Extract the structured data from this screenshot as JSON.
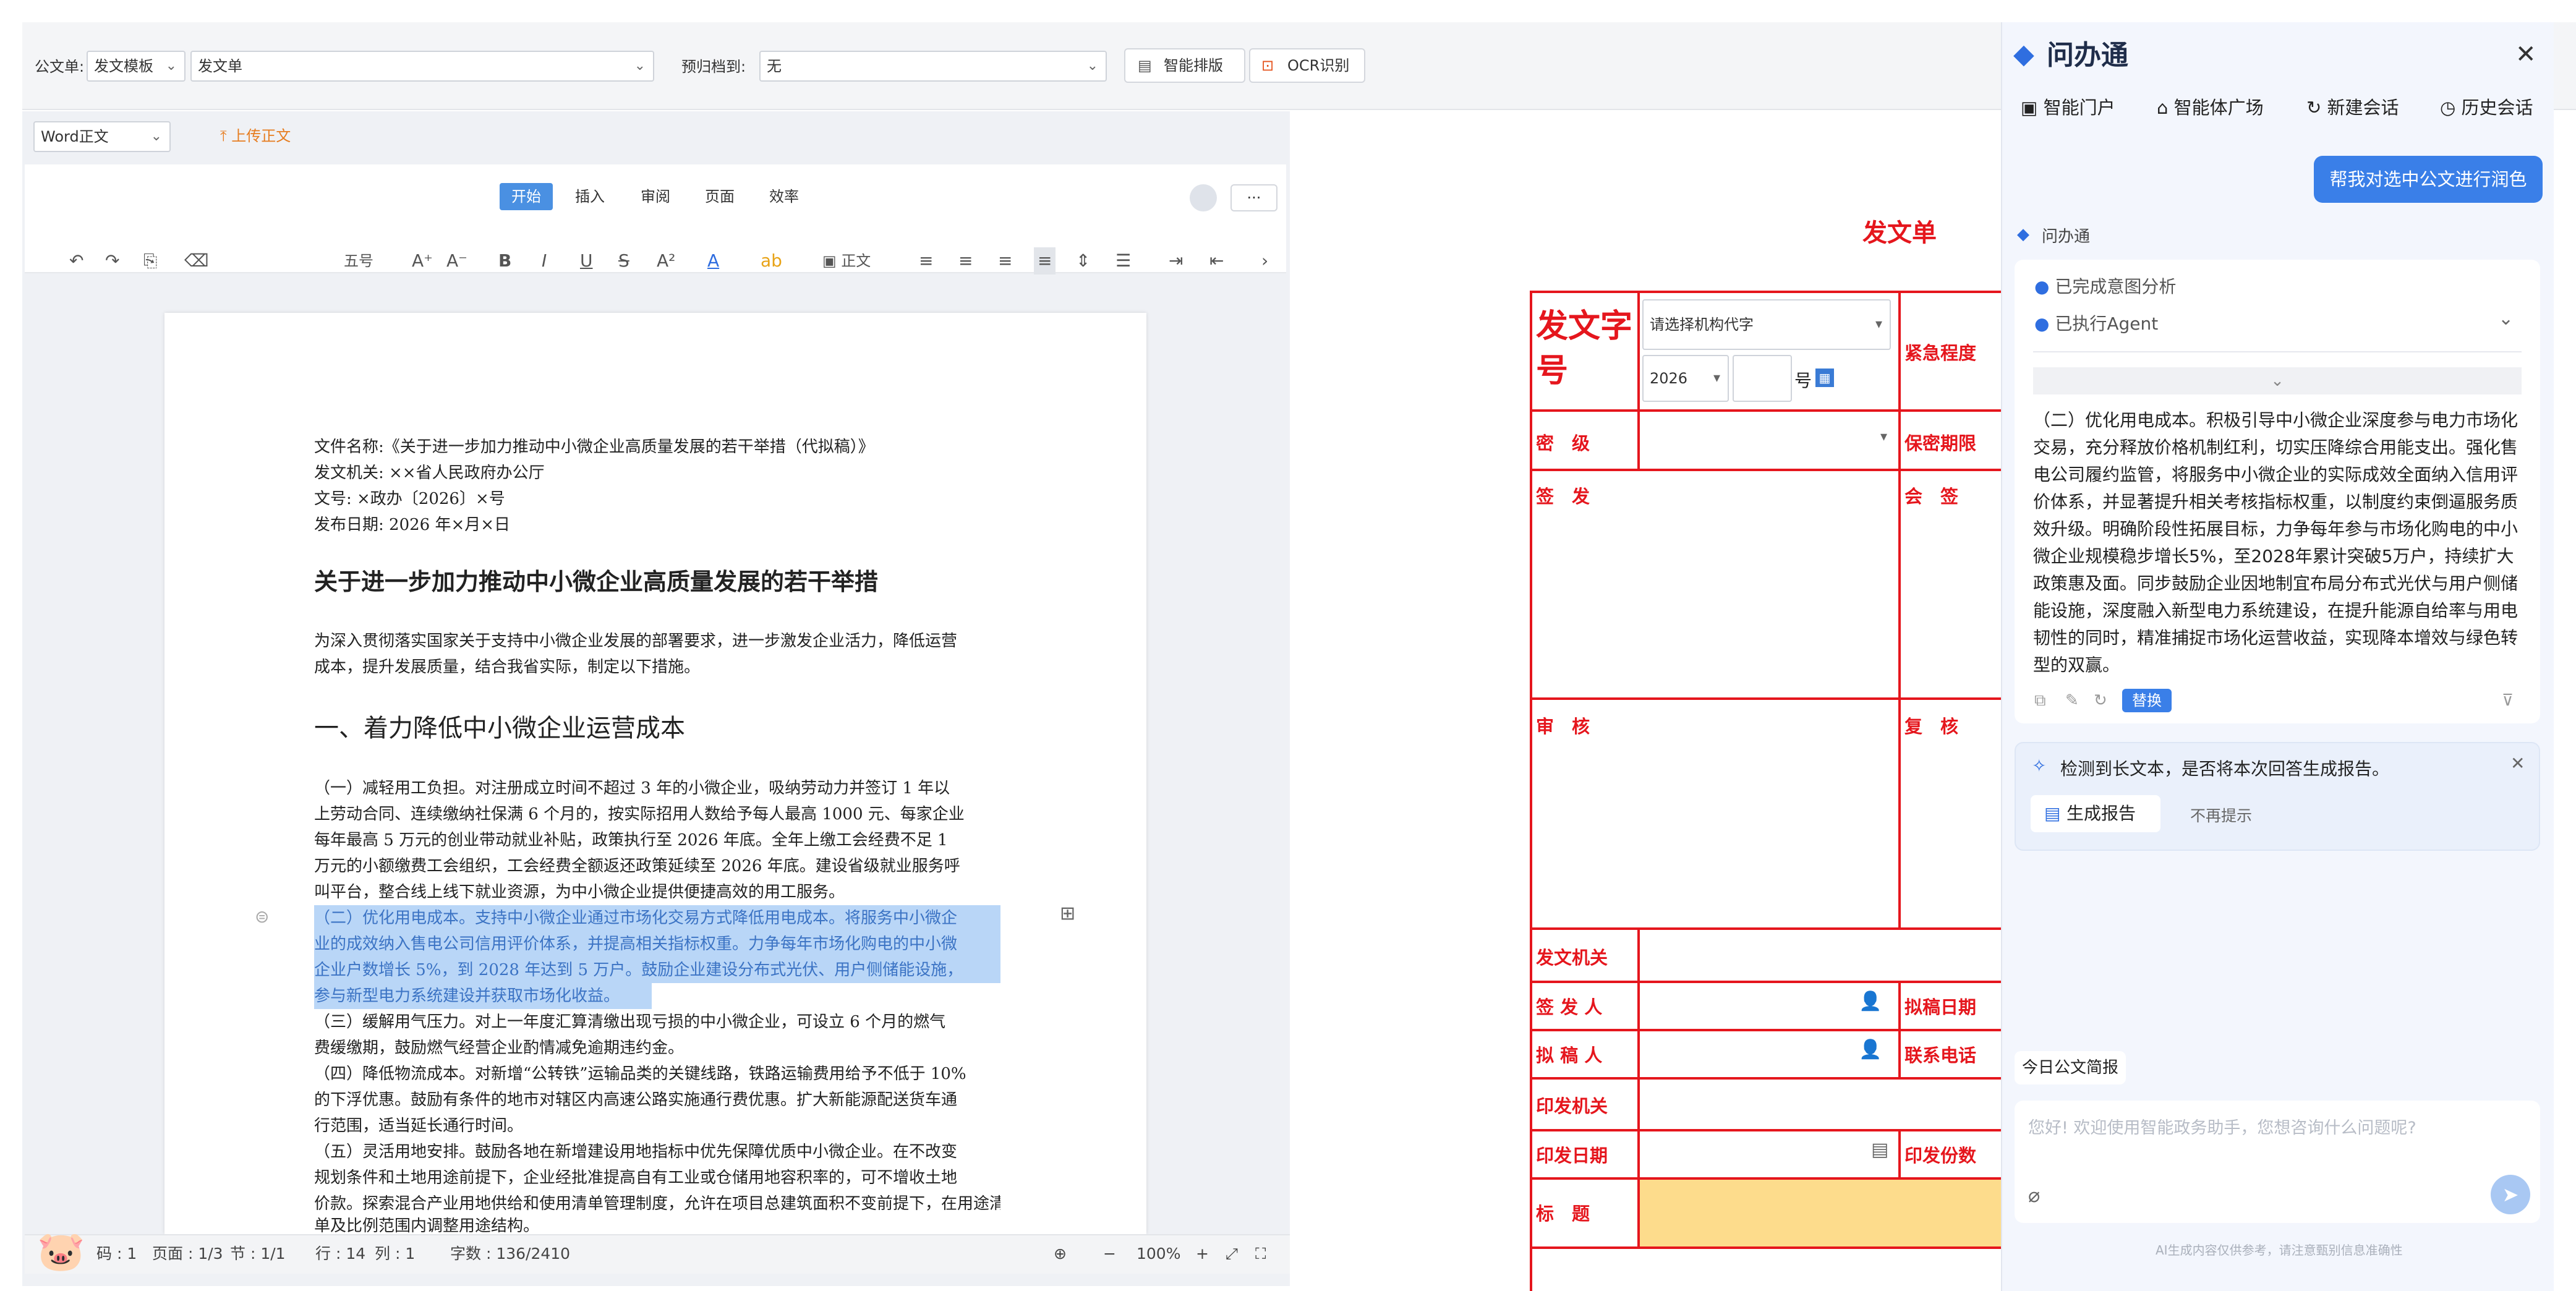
{
  "topbar": {
    "doc_label": "公文单:",
    "template_select": "发文模板",
    "form_select": "发文单",
    "archive_label": "预归档到:",
    "archive_select": "无",
    "smart_layout": "智能排版",
    "ocr": "OCR识别"
  },
  "editor": {
    "format_select": "Word正文",
    "upload": "上传正文",
    "tabs": [
      "开始",
      "插入",
      "审阅",
      "页面",
      "效率"
    ],
    "font_size": "五号",
    "style": "正文",
    "more": "···"
  },
  "doc": {
    "meta": [
      "文件名称:《关于进一步加力推动中小微企业高质量发展的若干举措（代拟稿）》",
      "发文机关: ××省人民政府办公厅",
      "文号: ×政办〔2026〕×号",
      "发布日期: 2026 年×月×日"
    ],
    "title": "关于进一步加力推动中小微企业高质量发展的若干举措",
    "intro": [
      "为深入贯彻落实国家关于支持中小微企业发展的部署要求，进一步激发企业活力，降低运营",
      "成本，提升发展质量，结合我省实际，制定以下措施。"
    ],
    "heading1": "一、着力降低中小微企业运营成本",
    "p1": [
      "（一）减轻用工负担。对注册成立时间不超过 3 年的小微企业，吸纳劳动力并签订 1 年以",
      "上劳动合同、连续缴纳社保满 6 个月的，按实际招用人数给予每人最高 1000 元、每家企业",
      "每年最高 5 万元的创业带动就业补贴，政策执行至 2026 年底。全年上缴工会经费不足 1",
      "万元的小额缴费工会组织，工会经费全额返还政策延续至 2026 年底。建设省级就业服务呼",
      "叫平台，整合线上线下就业资源，为中小微企业提供便捷高效的用工服务。"
    ],
    "p2_selected": [
      "（二）优化用电成本。支持中小微企业通过市场化交易方式降低用电成本。将服务中小微企",
      "业的成效纳入售电公司信用评价体系，并提高相关指标权重。力争每年市场化购电的中小微",
      "企业户数增长 5%，到 2028 年达到 5 万户。鼓励企业建设分布式光伏、用户侧储能设施，",
      "参与新型电力系统建设并获取市场化收益。"
    ],
    "p3": [
      "（三）缓解用气压力。对上一年度汇算清缴出现亏损的中小微企业，可设立 6 个月的燃气",
      "费缓缴期，鼓励燃气经营企业酌情减免逾期违约金。"
    ],
    "p4": [
      "（四）降低物流成本。对新增“公转铁”运输品类的关键线路，铁路运输费用给予不低于 10%",
      "的下浮优惠。鼓励有条件的地市对辖区内高速公路实施通行费优惠。扩大新能源配送货车通",
      "行范围，适当延长通行时间。"
    ],
    "p5": [
      "（五）灵活用地安排。鼓励各地在新增建设用地指标中优先保障优质中小微企业。在不改变",
      "规划条件和土地用途前提下，企业经批准提高自有工业或仓储用地容积率的，可不增收土地",
      "价款。探索混合产业用地供给和使用清单管理制度，允许在项目总建筑面积不变前提下，在用途清",
      "单及比例范围内调整用途结构。"
    ]
  },
  "statusbar": {
    "page_code": "码 : 1",
    "page": "页面 : 1/3",
    "section": "节 : 1/1",
    "row": "行 : 14",
    "col": "列 : 1",
    "words": "字数 : 136/2410",
    "zoom": "100%"
  },
  "form": {
    "title": "发文单",
    "zihao": "发文字号",
    "org_select": "请选择机构代字",
    "year": "2026",
    "hao": "号",
    "urgency": "紧急程度",
    "secret": "密　级",
    "secret_period": "保密期限",
    "sign": "签　发",
    "countersign": "会　签",
    "review": "审　核",
    "recheck": "复　核",
    "issuer_org": "发文机关",
    "signer": "签 发 人",
    "draft_date": "拟稿日期",
    "drafter": "拟 稿 人",
    "phone": "联系电话",
    "print_org": "印发机关",
    "print_date": "印发日期",
    "print_copies": "印发份数",
    "subject": "标　题"
  },
  "assistant": {
    "logo": "问办通",
    "nav": [
      "智能门户",
      "智能体广场",
      "新建会话",
      "历史会话"
    ],
    "user_msg": "帮我对选中公文进行润色",
    "bot_name": "问办通",
    "steps": [
      "已完成意图分析",
      "已执行Agent"
    ],
    "answer": [
      "（二）优化用电成本。积极引导中小微企业深度参与电力市场化",
      "交易，充分释放价格机制红利，切实压降综合用能支出。强化售",
      "电公司履约监管，将服务中小微企业的实际成效全面纳入信用评",
      "价体系，并显著提升相关考核指标权重，以制度约束倒逼服务质",
      "效升级。明确阶段性拓展目标，力争每年参与市场化购电的中小",
      "微企业规模稳步增长5%，至2028年累计突破5万户，持续扩大",
      "政策惠及面。同步鼓励企业因地制宜布局分布式光伏与用户侧储",
      "能设施，深度融入新型电力系统建设，在提升能源自给率与用电",
      "韧性的同时，精准捕捉市场化运营收益，实现降本增效与绿色转",
      "型的双赢。"
    ],
    "replace": "替换",
    "notice": "检测到长文本，是否将本次回答生成报告。",
    "gen_report": "生成报告",
    "no_prompt": "不再提示",
    "brief": "今日公文简报",
    "placeholder": "您好! 欢迎使用智能政务助手，您想咨询什么问题呢?",
    "disclaimer": "AI生成内容仅供参考，请注意甄别信息准确性"
  }
}
